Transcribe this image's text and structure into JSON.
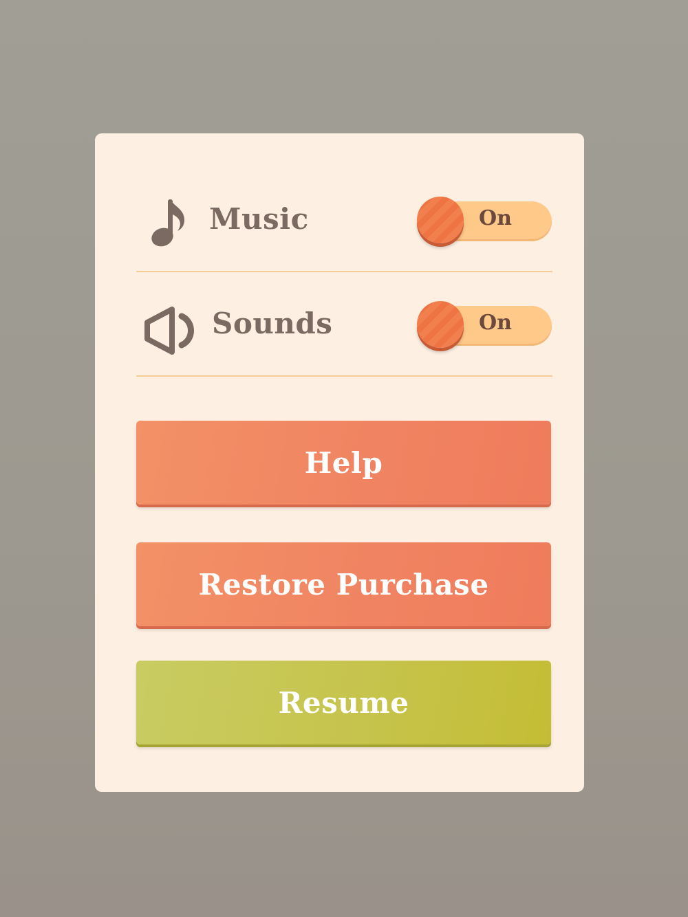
{
  "settings": {
    "music": {
      "label": "Music",
      "icon": "music-note-icon",
      "state": "On"
    },
    "sounds": {
      "label": "Sounds",
      "icon": "speaker-icon",
      "state": "On"
    }
  },
  "buttons": {
    "help": "Help",
    "restore": "Restore Purchase",
    "resume": "Resume"
  },
  "colors": {
    "panel": "#fdf0e3",
    "accent_orange": "#f08462",
    "accent_green": "#c6c34a",
    "toggle_track": "#ffc98a",
    "label_text": "#7a6a62",
    "divider": "#f6cc98"
  }
}
